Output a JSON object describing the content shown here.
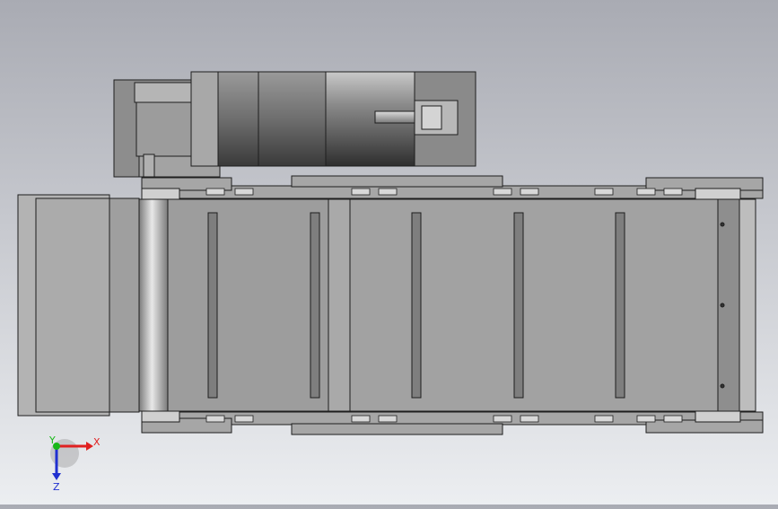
{
  "viewport": {
    "background_top": "#a9abb3",
    "background_bottom": "#eceef1"
  },
  "model": {
    "part_color": "#9a9a9a",
    "edge_color": "#1e1e1e",
    "components": [
      "gear-motor",
      "motor-shaft",
      "conveyor-frame",
      "conveyor-belt",
      "drive-roller",
      "idler-roller",
      "side-rails",
      "hopper-plate",
      "belt-cleats"
    ]
  },
  "triad": {
    "x_label": "X",
    "y_label": "Y",
    "z_label": "Z",
    "x_color": "#e02020",
    "y_color": "#18b818",
    "z_color": "#2030d0"
  }
}
